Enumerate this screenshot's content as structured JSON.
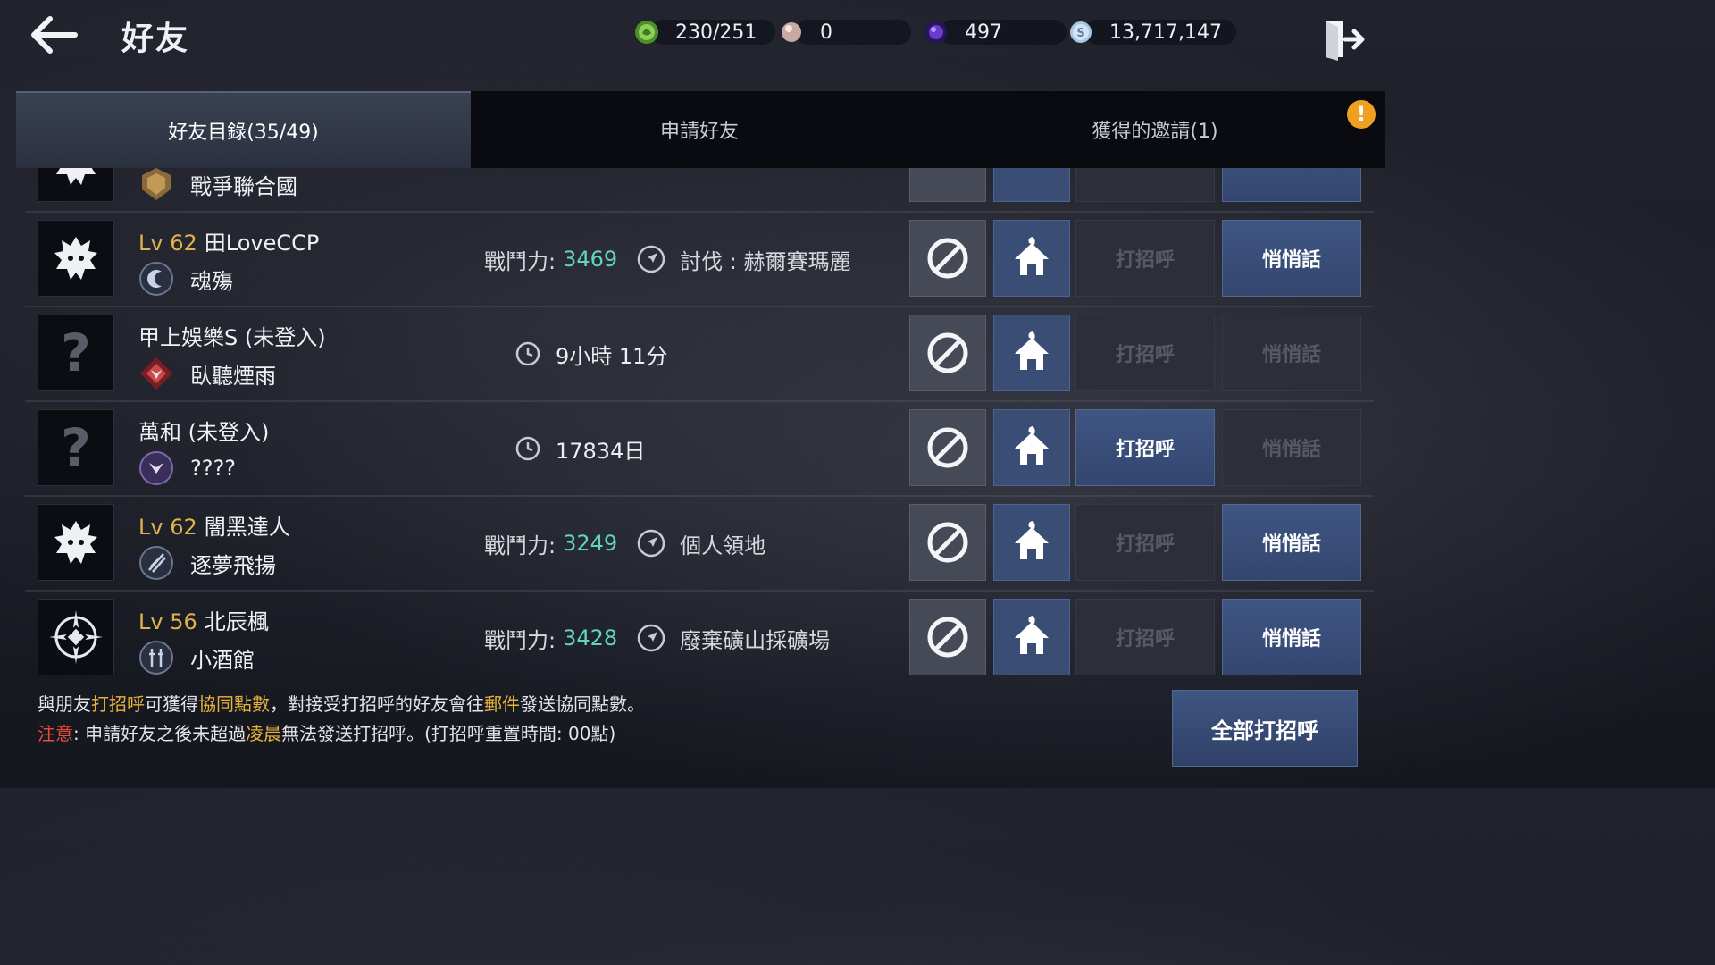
{
  "header": {
    "title": "好友",
    "back_icon": "arrow-left-icon",
    "exit_icon": "exit-door-icon"
  },
  "currencies": [
    {
      "name": "stamina",
      "icon": "green-orb-icon",
      "color": "#7bbf4a",
      "value": "230/251"
    },
    {
      "name": "pearl",
      "icon": "pearl-icon",
      "color": "#d9b9b0",
      "value": "0"
    },
    {
      "name": "purple-crystal",
      "icon": "purple-crystal-icon",
      "color": "#6a3cc8",
      "value": "497"
    },
    {
      "name": "silver",
      "icon": "silver-coin-icon",
      "color": "#b8d3ea",
      "value": "13,717,147"
    }
  ],
  "tabs": [
    {
      "label": "好友目錄(35/49)",
      "active": true
    },
    {
      "label": "申請好友",
      "active": false
    },
    {
      "label": "獲得的邀請(1)",
      "active": false
    }
  ],
  "alert_badge": "!",
  "partial_row": {
    "guild": "戰爭聯合國"
  },
  "friends": [
    {
      "level": "Lv 62",
      "name": "田LoveCCP",
      "guild": "魂殤",
      "online": true,
      "power_label": "戰鬥力:",
      "power": "3469",
      "location": "討伐 : 赫爾賽瑪麗",
      "greet_enabled": false,
      "whisper_enabled": true
    },
    {
      "level": "",
      "name": "甲上娛樂S (未登入)",
      "guild": "臥聽煙雨",
      "online": false,
      "last_seen": "9小時 11分",
      "greet_enabled": false,
      "whisper_enabled": false
    },
    {
      "level": "",
      "name": "萬和 (未登入)",
      "guild": "????",
      "online": false,
      "last_seen": "17834日",
      "greet_enabled": true,
      "whisper_enabled": false
    },
    {
      "level": "Lv 62",
      "name": "闇黑達人",
      "guild": "逐夢飛揚",
      "online": true,
      "power_label": "戰鬥力:",
      "power": "3249",
      "location": "個人領地",
      "greet_enabled": false,
      "whisper_enabled": true
    },
    {
      "level": "Lv 56",
      "name": "北辰楓",
      "guild": "小酒館",
      "online": true,
      "power_label": "戰鬥力:",
      "power": "3428",
      "location": "廢棄礦山採礦場",
      "greet_enabled": false,
      "whisper_enabled": true
    }
  ],
  "buttons": {
    "greet": "打招呼",
    "whisper": "悄悄話",
    "greet_all": "全部打招呼"
  },
  "footer": {
    "line1": {
      "t1": "與朋友",
      "h1": "打招呼",
      "t2": "可獲得",
      "h2": "協同點數",
      "t3": "，對接受打招呼的好友會往",
      "h3": "郵件",
      "t4": "發送協同點數。"
    },
    "line2": {
      "warn": "注意",
      "t1": ": 申請好友之後未超過",
      "h1": "凌晨",
      "t2": "無法發送打招呼。(打招呼重置時間: 00點)"
    }
  }
}
